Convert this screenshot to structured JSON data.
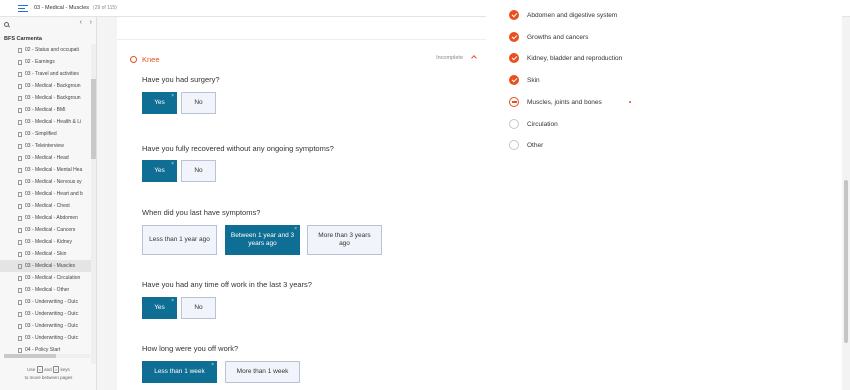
{
  "topbar": {
    "page_name": "03 - Medical - Muscles",
    "page_count": "(29 of 115)",
    "brand": "axure"
  },
  "sidebar": {
    "project": "BFS Carmenta",
    "pages": [
      {
        "label": "02 - Status and occupati",
        "selected": false
      },
      {
        "label": "02 - Earnings",
        "selected": false
      },
      {
        "label": "03 - Travel and activities",
        "selected": false
      },
      {
        "label": "03 - Medical - Backgroun",
        "selected": false
      },
      {
        "label": "03 - Medical - Backgroun",
        "selected": false
      },
      {
        "label": "03 - Medical - BMI",
        "selected": false
      },
      {
        "label": "03 - Medical - Health & Li",
        "selected": false
      },
      {
        "label": "03 - Simplified",
        "selected": false
      },
      {
        "label": "03 - Teleinterview",
        "selected": false
      },
      {
        "label": "03 - Medical - Head",
        "selected": false
      },
      {
        "label": "03 - Medical - Mental Hea",
        "selected": false
      },
      {
        "label": "03 - Medical - Nervous sy",
        "selected": false
      },
      {
        "label": "03 - Medical - Heart and b",
        "selected": false
      },
      {
        "label": "03 - Medical - Chest",
        "selected": false
      },
      {
        "label": "03 - Medical - Abdomen",
        "selected": false
      },
      {
        "label": "03 - Medical - Cancers",
        "selected": false
      },
      {
        "label": "03 - Medical - Kidney",
        "selected": false
      },
      {
        "label": "03 - Medical - Skin",
        "selected": false
      },
      {
        "label": "03 - Medical - Muscles",
        "selected": true
      },
      {
        "label": "03 - Medical - Circulation",
        "selected": false
      },
      {
        "label": "03 - Medical - Other",
        "selected": false
      },
      {
        "label": "03 - Underwriting - Outc",
        "selected": false
      },
      {
        "label": "03 - Underwriting - Outc",
        "selected": false
      },
      {
        "label": "03 - Underwriting - Outc",
        "selected": false
      },
      {
        "label": "03 - Underwriting - Outc",
        "selected": false
      },
      {
        "label": "04 - Policy Start",
        "selected": false
      }
    ],
    "hint_use": "Use",
    "hint_key1": "<",
    "hint_and": "and",
    "hint_key2": ">",
    "hint_keys": "keys",
    "hint_line2": "to move between pages"
  },
  "form": {
    "section_title": "Knee",
    "section_status": "Incomplete",
    "questions": [
      {
        "text": "Have you had surgery?",
        "options": [
          "Yes",
          "No"
        ],
        "selected": 0
      },
      {
        "text": "Have you fully recovered without any ongoing symptoms?",
        "options": [
          "Yes",
          "No"
        ],
        "selected": 0
      },
      {
        "text": "When did you last have symptoms?",
        "options": [
          "Less than 1 year ago",
          "Between 1 year and 3 years ago",
          "More than 3 years ago"
        ],
        "selected": 1
      },
      {
        "text": "Have you had any time off work in the last 3 years?",
        "options": [
          "Yes",
          "No"
        ],
        "selected": 0
      },
      {
        "text": "How long were you off work?",
        "options": [
          "Less than 1 week",
          "More than 1 week"
        ],
        "selected": 0
      }
    ]
  },
  "progress": {
    "steps": [
      {
        "label": "Abdomen and digestive system",
        "state": "done"
      },
      {
        "label": "Growths and cancers",
        "state": "done"
      },
      {
        "label": "Kidney, bladder and reproduction",
        "state": "done"
      },
      {
        "label": "Skin",
        "state": "done"
      },
      {
        "label": "Muscles, joints and bones",
        "state": "current"
      },
      {
        "label": "Circulation",
        "state": "todo"
      },
      {
        "label": "Other",
        "state": "todo"
      }
    ]
  },
  "colors": {
    "accent": "#e8501e",
    "selected_option": "#0f6e93",
    "option_bg": "#f1f5fb"
  }
}
